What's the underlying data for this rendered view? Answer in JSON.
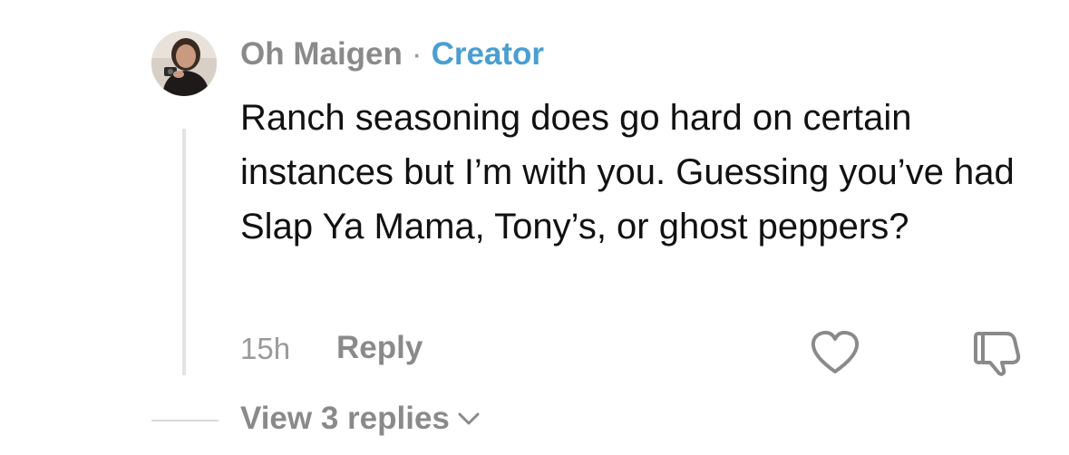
{
  "comment": {
    "author": "Oh Maigen",
    "separator": "·",
    "badge": "Creator",
    "text": "Ranch seasoning does go hard on certain instances but I’m with you. Guessing you’ve had Slap Ya Mama, Tony’s, or ghost peppers?",
    "time": "15h",
    "reply_label": "Reply",
    "view_replies_label": "View 3 replies"
  },
  "icons": {
    "avatar": "avatar",
    "like": "heart-icon",
    "dislike": "thumbs-down-icon",
    "expand": "chevron-down-icon"
  },
  "colors": {
    "creator_badge": "#4a9fd0",
    "muted_text": "#8a8a8a",
    "body_text": "#111111",
    "thread_line": "#e3e3e3"
  }
}
